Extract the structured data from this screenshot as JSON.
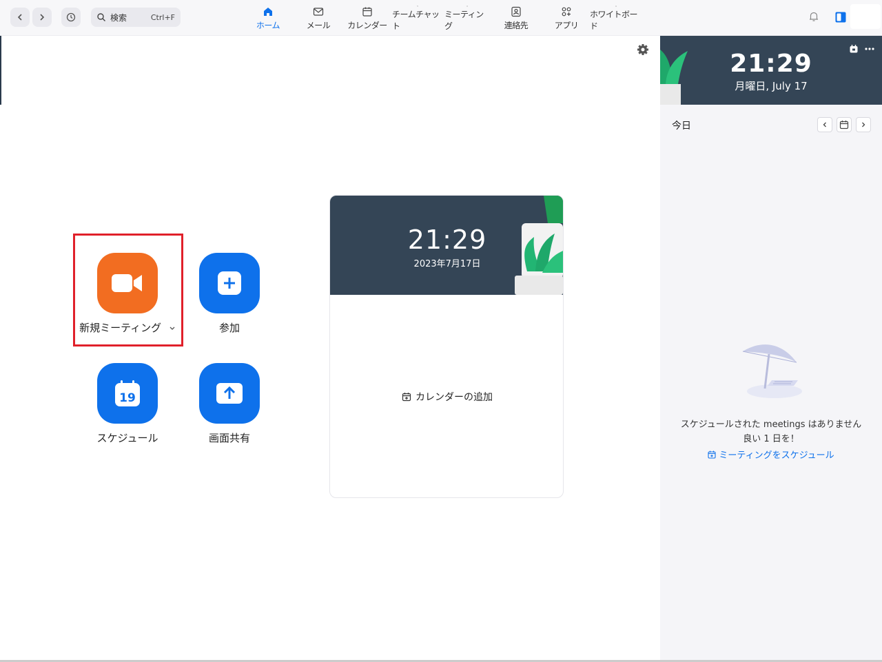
{
  "toolbar": {
    "search_label": "検索",
    "search_shortcut": "Ctrl+F"
  },
  "tabs": [
    {
      "label": "ホーム",
      "icon": "home-icon",
      "active": true
    },
    {
      "label": "メール",
      "icon": "mail-icon"
    },
    {
      "label": "カレンダー",
      "icon": "calendar-icon"
    },
    {
      "label": "チームチャット",
      "icon": "chat-icon"
    },
    {
      "label": "ミーティング",
      "icon": "video-icon"
    },
    {
      "label": "連絡先",
      "icon": "contact-icon"
    },
    {
      "label": "アプリ",
      "icon": "apps-icon"
    },
    {
      "label": "ホワイトボード",
      "icon": "whiteboard-icon"
    }
  ],
  "actions": {
    "new_meeting": "新規ミーティング",
    "join": "参加",
    "schedule": "スケジュール",
    "schedule_day": "19",
    "share_screen": "画面共有"
  },
  "card": {
    "time": "21:29",
    "date": "2023年7月17日",
    "add_calendar": "カレンダーの追加"
  },
  "right_panel": {
    "time": "21:29",
    "date": "月曜日, July 17",
    "today_label": "今日",
    "empty_message": "スケジュールされた meetings はありません",
    "empty_sub": "良い 1 日を！",
    "schedule_link": "ミーティングをスケジュール"
  },
  "colors": {
    "accent": "#0e71eb",
    "new_meeting": "#f26d21",
    "header_bg": "#344556",
    "highlight": "#e0202a"
  }
}
